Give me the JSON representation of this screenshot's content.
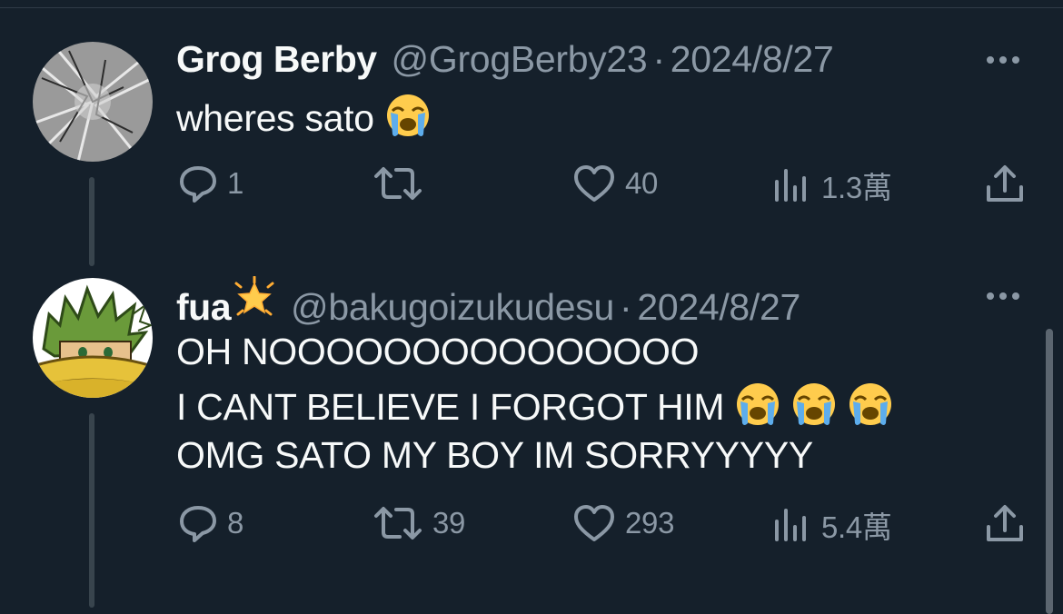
{
  "tweets": [
    {
      "name": "Grog Berby",
      "name_badge": "",
      "handle": "@GrogBerby23",
      "separator": "·",
      "date": "2024/8/27",
      "lines": [
        "wheres sato"
      ],
      "line_emojis": [
        1
      ],
      "replies": "1",
      "retweets": "",
      "likes": "40",
      "views": "1.3萬"
    },
    {
      "name": "fua",
      "name_badge": "glowing-star",
      "handle": "@bakugoizukudesu",
      "separator": "·",
      "date": "2024/8/27",
      "lines": [
        "OH NOOOOOOOOOOOOOOO",
        "I CANT BELIEVE I FORGOT HIM",
        "OMG SATO MY BOY IM SORRYYYYY"
      ],
      "line_emojis": [
        0,
        3,
        0
      ],
      "replies": "8",
      "retweets": "39",
      "likes": "293",
      "views": "5.4萬"
    }
  ],
  "icons": {
    "reply": "reply-icon",
    "retweet": "retweet-icon",
    "like": "heart-icon",
    "views": "views-icon",
    "share": "share-icon",
    "more": "more-icon",
    "emoji": "loudly-crying-face-emoji"
  },
  "colors": {
    "background": "#15202b",
    "text": "#f7f9f9",
    "secondary": "#8b98a5",
    "thread_line": "#38444d"
  }
}
